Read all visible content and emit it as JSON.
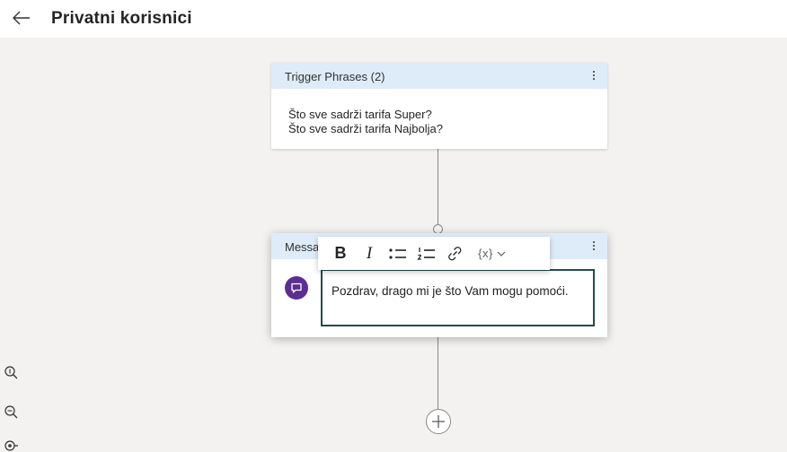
{
  "header": {
    "title": "Privatni korisnici"
  },
  "trigger_node": {
    "title": "Trigger Phrases (2)",
    "phrases": [
      "Što sve sadrži tarifa Super?",
      "Što sve sadrži tarifa Najbolja?"
    ]
  },
  "message_node": {
    "title": "Messa",
    "text": "Pozdrav, drago mi je što Vam mogu pomoći."
  },
  "toolbar": {
    "bold_label": "B",
    "italic_label": "I",
    "variable_label": "{x}"
  },
  "icons": {
    "back": "arrow-left-icon",
    "message": "chat-bubble-icon",
    "bullet_list": "bullet-list-icon",
    "numbered_list": "numbered-list-icon",
    "link": "link-icon",
    "zoom_in": "zoom-in-icon",
    "zoom_out": "zoom-out-icon",
    "fit": "fit-view-icon",
    "add": "plus-icon"
  },
  "colors": {
    "node_header": "#deecf9",
    "message_icon": "#5c2e91",
    "editor_border": "#1e4e4a",
    "canvas": "#f3f2f1"
  }
}
